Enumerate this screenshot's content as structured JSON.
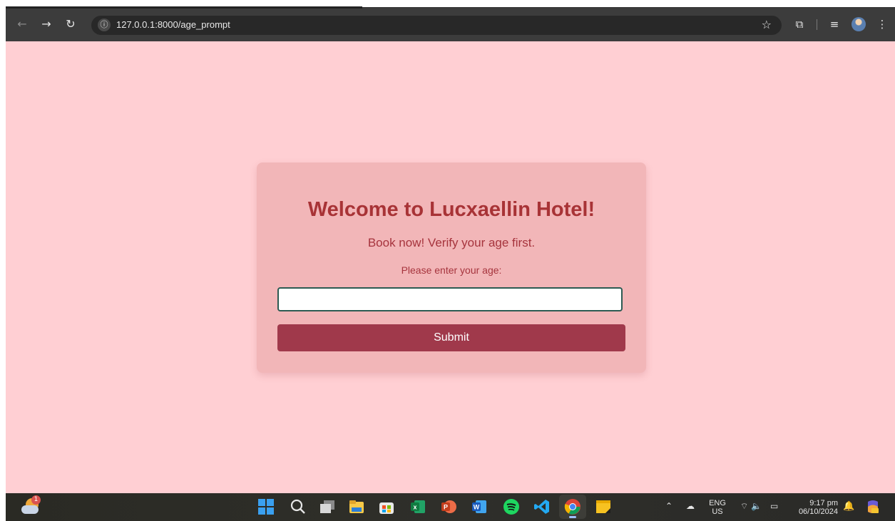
{
  "browser": {
    "url": "127.0.0.1:8000/age_prompt",
    "icons": [
      "back-icon",
      "forward-icon",
      "reload-icon",
      "site-info-icon",
      "bookmark-star-icon",
      "extensions-icon",
      "reading-list-icon",
      "profile-avatar",
      "menu-icon"
    ]
  },
  "page": {
    "background": "#ffcfd3",
    "card": {
      "title": "Welcome to Lucxaellin Hotel!",
      "subtitle": "Book now! Verify your age first.",
      "label": "Please enter your age:",
      "input_value": "",
      "input_placeholder": "",
      "submit_label": "Submit",
      "colors": {
        "card": "#f2b6b8",
        "title": "#a83336",
        "button": "#a0394b",
        "input_border": "#2d5a52"
      }
    }
  },
  "taskbar": {
    "weather_badge": "1",
    "apps": [
      "start-icon",
      "search-icon",
      "task-view-icon",
      "file-explorer-icon",
      "microsoft-store-icon",
      "excel-icon",
      "powerpoint-icon",
      "word-icon",
      "spotify-icon",
      "vscode-icon",
      "chrome-icon",
      "sticky-notes-icon"
    ],
    "language_line1": "ENG",
    "language_line2": "US",
    "time": "9:17 pm",
    "date": "06/10/2024"
  }
}
